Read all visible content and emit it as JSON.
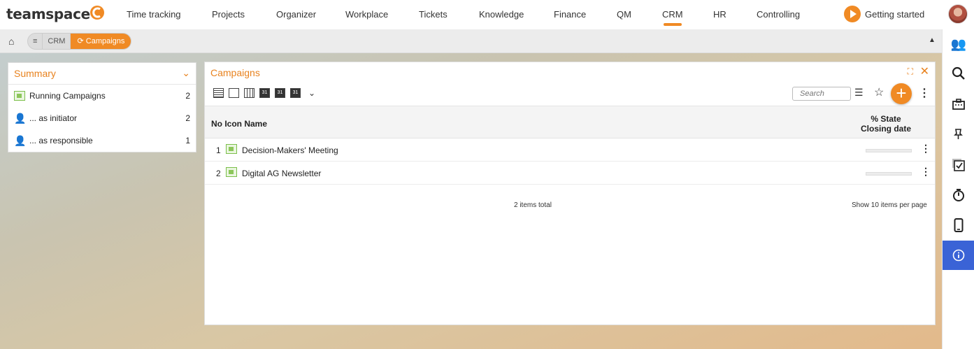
{
  "brand": {
    "name": "teamspace",
    "accent": "#f08a24"
  },
  "nav": {
    "items": [
      {
        "label": "Time tracking"
      },
      {
        "label": "Projects"
      },
      {
        "label": "Organizer"
      },
      {
        "label": "Workplace"
      },
      {
        "label": "Tickets"
      },
      {
        "label": "Knowledge"
      },
      {
        "label": "Finance"
      },
      {
        "label": "QM"
      },
      {
        "label": "CRM",
        "active": true
      },
      {
        "label": "HR"
      },
      {
        "label": "Controlling"
      }
    ],
    "getting_started": "Getting started"
  },
  "breadcrumb": {
    "menu_icon": "≡",
    "items": [
      "CRM",
      "Campaigns"
    ]
  },
  "summary": {
    "title": "Summary",
    "rows": [
      {
        "label": "Running Campaigns",
        "count": "2",
        "icon": "campaign-icon"
      },
      {
        "label": "... as initiator",
        "count": "2",
        "icon": "person-icon"
      },
      {
        "label": "... as responsible",
        "count": "1",
        "icon": "person-icon"
      }
    ]
  },
  "campaigns": {
    "title": "Campaigns",
    "search_placeholder": "Search",
    "toolbar_day_label": "31",
    "columns": {
      "left": "No Icon Name",
      "right_line1": "% State",
      "right_line2": "Closing date"
    },
    "rows": [
      {
        "no": "1",
        "name": "Decision-Makers' Meeting"
      },
      {
        "no": "2",
        "name": "Digital AG Newsletter"
      }
    ],
    "total": "2 items total",
    "paging": {
      "prefix": "Show",
      "count": "10",
      "suffix": "items per page"
    }
  },
  "right_sidebar": {
    "icons": [
      "contacts-icon",
      "search-icon",
      "inbox-icon",
      "pin-icon",
      "tasks-icon",
      "timer-icon",
      "mobile-icon",
      "info-icon"
    ]
  }
}
